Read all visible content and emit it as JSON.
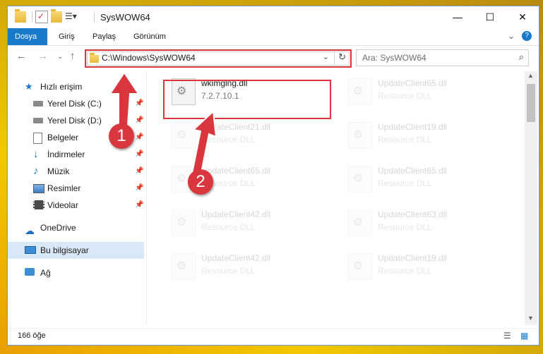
{
  "window": {
    "title": "SysWOW64",
    "minimize": "—",
    "maximize": "☐",
    "close": "✕"
  },
  "ribbon": {
    "tabs": [
      "Dosya",
      "Giriş",
      "Paylaş",
      "Görünüm"
    ],
    "expand": "⌄",
    "help": "?"
  },
  "address": {
    "back": "←",
    "forward": "→",
    "recent": "⌄",
    "up": "↑",
    "path": "C:\\Windows\\SysWOW64",
    "dropdown": "⌄",
    "refresh": "↻",
    "search_placeholder": "Ara: SysWOW64",
    "search_icon": "⌕"
  },
  "sidebar": {
    "items": [
      {
        "label": "Hızlı erişim",
        "icon": "star-icon",
        "pinned": false
      },
      {
        "label": "Yerel Disk (C:)",
        "icon": "drive-icon",
        "pinned": true
      },
      {
        "label": "Yerel Disk (D:)",
        "icon": "drive-icon",
        "pinned": true
      },
      {
        "label": "Belgeler",
        "icon": "documents-icon",
        "pinned": true
      },
      {
        "label": "İndirmeler",
        "icon": "download-icon",
        "pinned": true
      },
      {
        "label": "Müzik",
        "icon": "music-icon",
        "pinned": true
      },
      {
        "label": "Resimler",
        "icon": "pictures-icon",
        "pinned": true
      },
      {
        "label": "Videolar",
        "icon": "videos-icon",
        "pinned": true
      },
      {
        "label": "OneDrive",
        "icon": "cloud-icon",
        "pinned": false
      },
      {
        "label": "Bu bilgisayar",
        "icon": "computer-icon",
        "pinned": false
      },
      {
        "label": "Ağ",
        "icon": "network-icon",
        "pinned": false
      }
    ],
    "pin_glyph": "📌"
  },
  "files": [
    {
      "name": "wkimglng.dll",
      "detail": "7.2.7.10.1",
      "faded": false
    },
    {
      "name": "UpdateClient65.dll",
      "detail": "Resource DLL",
      "faded": true
    },
    {
      "name": "UpdateClient21.dll",
      "detail": "Resource DLL",
      "faded": true
    },
    {
      "name": "UpdateClient19.dll",
      "detail": "Resource DLL",
      "faded": true
    },
    {
      "name": "UpdateClient65.dll",
      "detail": "Resource DLL",
      "faded": true
    },
    {
      "name": "UpdateClient65.dll",
      "detail": "Resource DLL",
      "faded": true
    },
    {
      "name": "UpdateClient42.dll",
      "detail": "Resource DLL",
      "faded": true
    },
    {
      "name": "UpdateClient63.dll",
      "detail": "Resource DLL",
      "faded": true
    },
    {
      "name": "UpdateClient42.dll",
      "detail": "Resource DLL",
      "faded": true
    },
    {
      "name": "UpdateClient19.dll",
      "detail": "Resource DLL",
      "faded": true
    }
  ],
  "status": {
    "count": "166 öğe",
    "details_view": "☰",
    "icons_view": "▦"
  },
  "annotations": {
    "badge1": "1",
    "badge2": "2",
    "color": "#d9363e"
  }
}
